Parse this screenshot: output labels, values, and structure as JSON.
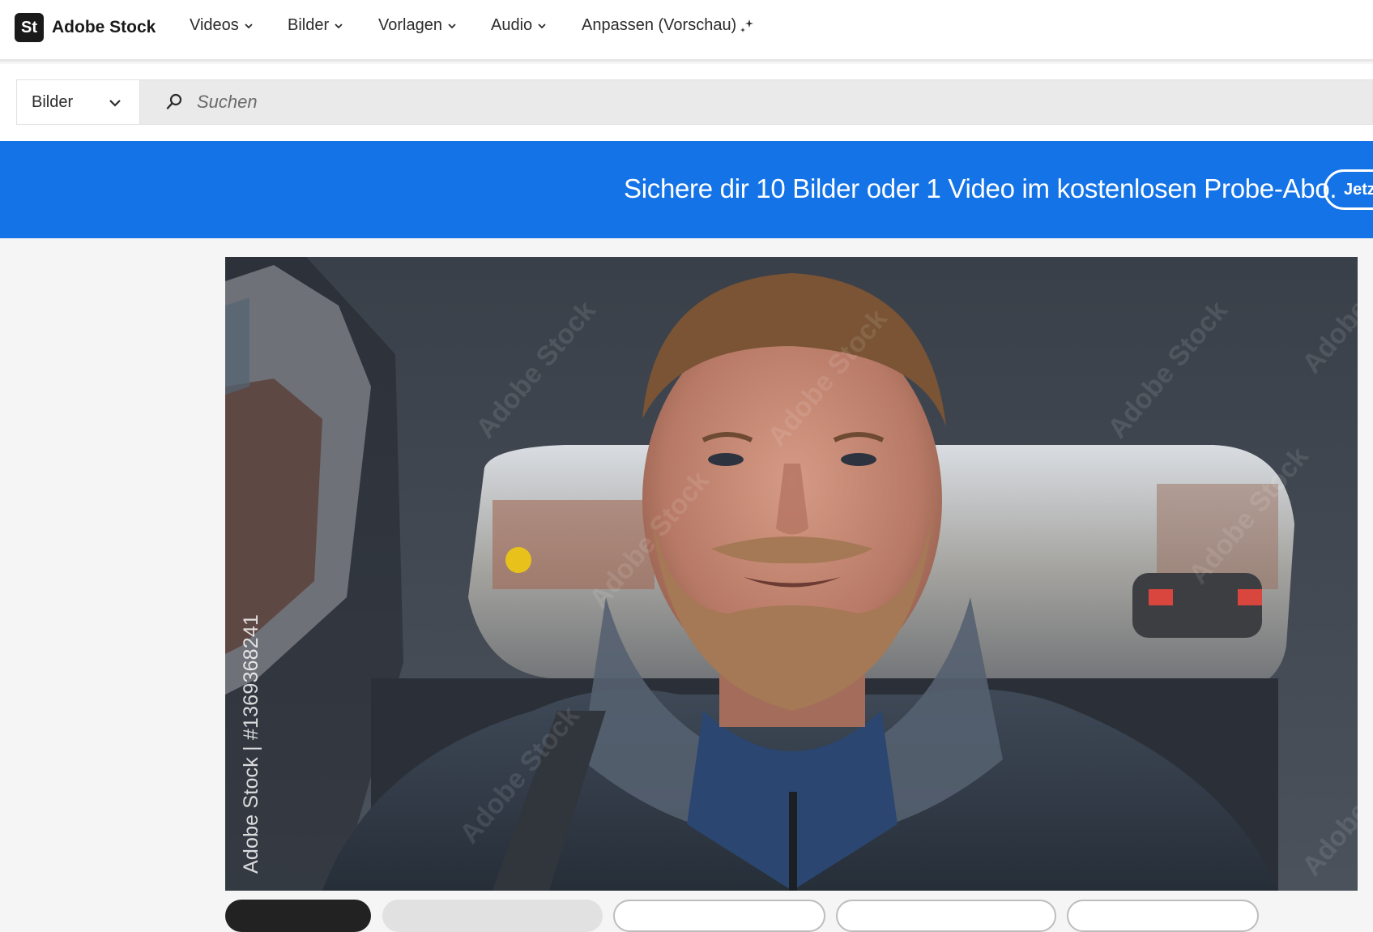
{
  "brand": {
    "badge": "St",
    "name": "Adobe Stock"
  },
  "nav": {
    "items": [
      {
        "label": "Videos",
        "has_chevron": true
      },
      {
        "label": "Bilder",
        "has_chevron": true
      },
      {
        "label": "Vorlagen",
        "has_chevron": true
      },
      {
        "label": "Audio",
        "has_chevron": true
      },
      {
        "label": "Anpassen (Vorschau)",
        "has_chevron": false,
        "icon": "sparkle-icon"
      }
    ]
  },
  "search": {
    "scope_value": "Bilder",
    "placeholder": "Suchen"
  },
  "banner": {
    "text": "Sichere dir 10 Bilder oder 1 Video im kostenlosen Probe-Abo.",
    "button_label": "Jetzt"
  },
  "preview": {
    "watermark_id": "Adobe Stock | #1369368241",
    "watermark_text": "Adobe Stock"
  },
  "colors": {
    "banner": "#1473e6",
    "text": "#2c2c2c",
    "logo_bg": "#1a1a1a"
  }
}
